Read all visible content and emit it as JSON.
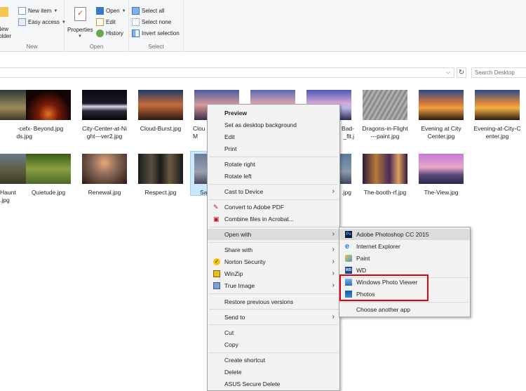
{
  "ribbon": {
    "new_group": {
      "new_folder": "New\nfolder",
      "new_item": "New item",
      "easy_access": "Easy access",
      "label": "New"
    },
    "open_group": {
      "properties": "Properties",
      "open": "Open",
      "edit": "Edit",
      "history": "History",
      "label": "Open"
    },
    "select_group": {
      "select_all": "Select all",
      "select_none": "Select none",
      "invert": "Invert selection",
      "label": "Select"
    }
  },
  "address": {
    "search_placeholder": "Search Desktop"
  },
  "files_row1": [
    "-cefx-\nds.jpg",
    "Beyond.jpg",
    "City-Center-at-Ni\nght---ver2.jpg",
    "Cloud-Burst.jpg",
    "Clou\nM",
    "",
    "Bad-\n_flt.j",
    "Dragons-in-Flight\n---paint.jpg",
    "Evening at City\nCenter.jpg",
    "Evening-at-City-C\nenter.jpg"
  ],
  "files_row2": [
    "Haunt\n.jpg",
    "Quietude.jpg",
    "Renewal.jpg",
    "Respect.jpg",
    "Sa",
    "",
    ".jpg",
    "The-booth-rf.jpg",
    "The-View.jpg"
  ],
  "context_menu": {
    "preview": "Preview",
    "set_background": "Set as desktop background",
    "edit": "Edit",
    "print": "Print",
    "rotate_right": "Rotate right",
    "rotate_left": "Rotate left",
    "cast": "Cast to Device",
    "convert_pdf": "Convert to Adobe PDF",
    "combine_acrobat": "Combine files in Acrobat...",
    "open_with": "Open with",
    "share_with": "Share with",
    "norton": "Norton Security",
    "winzip": "WinZip",
    "true_image": "True Image",
    "restore": "Restore previous versions",
    "send_to": "Send to",
    "cut": "Cut",
    "copy": "Copy",
    "create_shortcut": "Create shortcut",
    "delete": "Delete",
    "asus_delete": "ASUS Secure Delete"
  },
  "open_with_menu": {
    "photoshop": "Adobe Photoshop CC 2015",
    "ie": "Internet Explorer",
    "paint": "Paint",
    "wd": "WD",
    "wpv": "Windows Photo Viewer",
    "photos": "Photos",
    "choose": "Choose another app"
  },
  "colors": {
    "highlight_box": "#e00010",
    "selection": "#cce8ff",
    "menu_bg": "#f2f2f2"
  }
}
